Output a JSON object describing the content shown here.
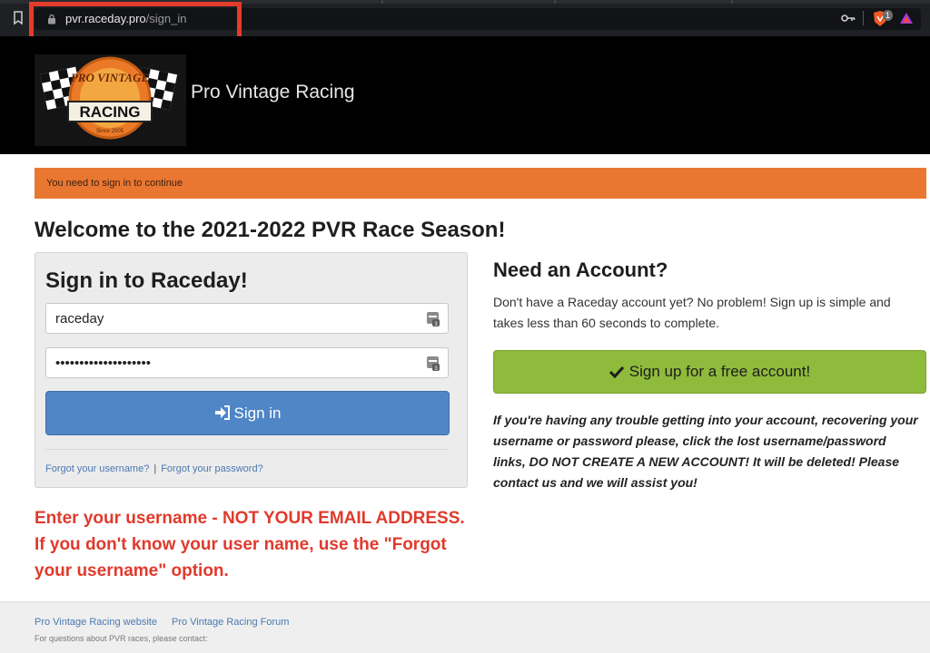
{
  "browser": {
    "url_host": "pvr.raceday.pro",
    "url_path": "/sign_in",
    "extension_badge": "1"
  },
  "header": {
    "site_title": "Pro Vintage Racing",
    "logo": {
      "line1": "PRO VINTAGE",
      "line2": "RACING",
      "line3": "Since 2005"
    }
  },
  "alert": {
    "text": "You need to sign in to continue"
  },
  "welcome": "Welcome to the 2021-2022 PVR Race Season!",
  "signin": {
    "title": "Sign in to Raceday!",
    "username_value": "raceday",
    "password_value": "••••••••••••••••••••",
    "button_label": "Sign in",
    "forgot_username": "Forgot your username?",
    "separator": "|",
    "forgot_password": "Forgot your password?"
  },
  "warning": "Enter your username - NOT YOUR EMAIL ADDRESS. If you don't know your user name, use the \"Forgot your username\" option.",
  "account": {
    "title": "Need an Account?",
    "text": "Don't have a Raceday account yet? No problem! Sign up is simple and takes less than 60 seconds to complete.",
    "signup_label": "Sign up for a free account!",
    "trouble_text": "If you're having any trouble getting into your account, recovering your username or password please, click the lost username/password links, DO NOT CREATE A NEW ACCOUNT! It will be deleted! Please contact us and we will assist you!"
  },
  "footer": {
    "link1": "Pro Vintage Racing website",
    "link2": "Pro Vintage Racing Forum",
    "note": "For questions about PVR races, please contact:"
  },
  "colors": {
    "alert_bg": "#ea7731",
    "signin_button": "#4f86c6",
    "signup_button": "#8fbb3d",
    "warning_text": "#e03a2c",
    "annotation_box": "#e53b2a"
  }
}
